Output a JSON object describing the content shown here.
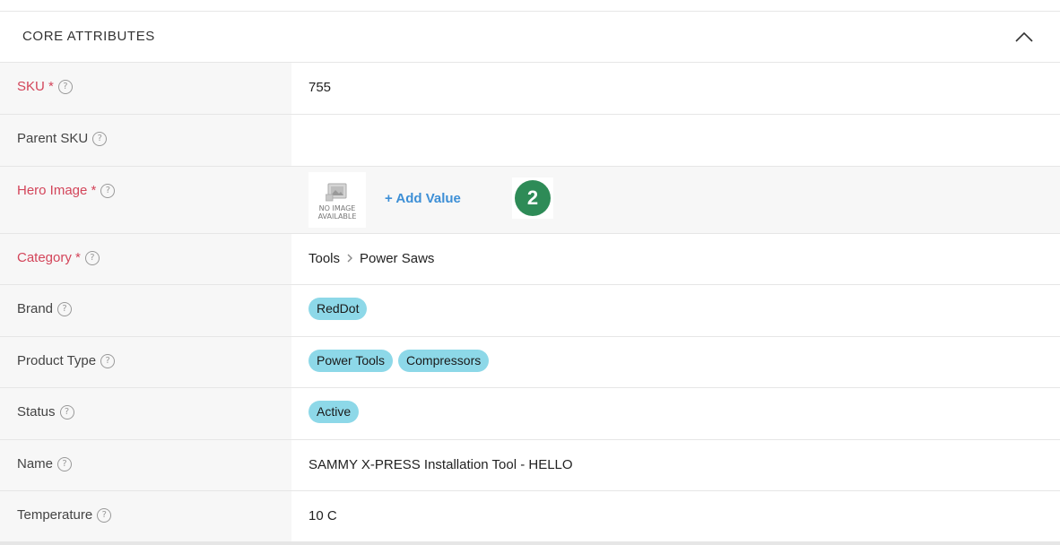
{
  "section": {
    "title": "CORE ATTRIBUTES",
    "collapse_icon": "chevron-up-icon"
  },
  "rows": {
    "sku": {
      "label": "SKU *",
      "value": "755",
      "help_glyph": "?"
    },
    "parent_sku": {
      "label": "Parent SKU",
      "value": "",
      "help_glyph": "?"
    },
    "hero_image": {
      "label": "Hero Image *",
      "placeholder_line1": "NO IMAGE",
      "placeholder_line2": "AVAILABLE",
      "add_value": "+ Add Value",
      "step_badge": "2",
      "help_glyph": "?"
    },
    "category": {
      "label": "Category *",
      "path": [
        "Tools",
        "Power Saws"
      ],
      "separator": ">",
      "help_glyph": "?"
    },
    "brand": {
      "label": "Brand",
      "chips": [
        "RedDot"
      ],
      "help_glyph": "?"
    },
    "product_type": {
      "label": "Product Type",
      "chips": [
        "Power Tools",
        "Compressors"
      ],
      "help_glyph": "?"
    },
    "status": {
      "label": "Status",
      "chips": [
        "Active"
      ],
      "help_glyph": "?"
    },
    "name": {
      "label": "Name",
      "value": "SAMMY X-PRESS Installation Tool - HELLO",
      "help_glyph": "?"
    },
    "temperature": {
      "label": "Temperature",
      "value": "10 C",
      "help_glyph": "?"
    }
  },
  "colors": {
    "required_label": "#d3455a",
    "chip_bg": "#8dd8e8",
    "link": "#3d8fd6",
    "step_badge": "#2e8b57",
    "label_bg": "#f7f7f7"
  }
}
